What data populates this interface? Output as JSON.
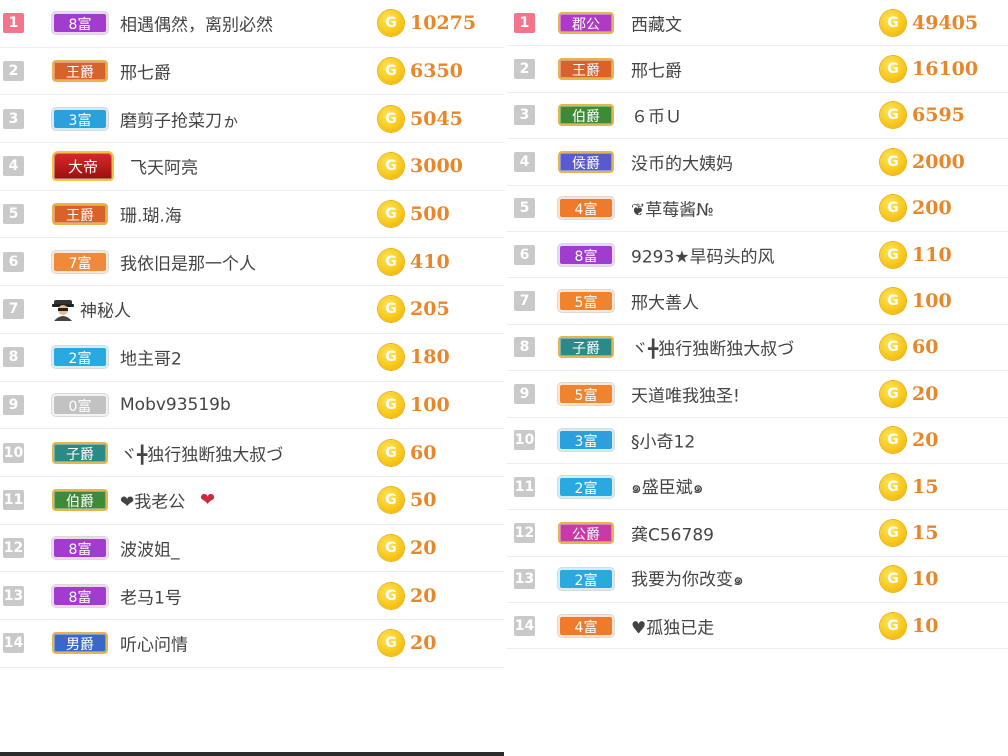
{
  "colors": {
    "rank_top": "#f2758b",
    "rank_default": "#c9c9c9",
    "amount": "#e8862a",
    "coin": "#f7c61a",
    "name_text": "#444444"
  },
  "coin_symbol": "G",
  "left_list": [
    {
      "rank": "1",
      "badge": "8富",
      "badge_color": "#a23ccf",
      "badge_type": "fu",
      "name": "相遇偶然，离别必然",
      "amount": "10275"
    },
    {
      "rank": "2",
      "badge": "王爵",
      "badge_color": "#d9612a",
      "badge_type": "title",
      "name": "邢七爵",
      "amount": "6350"
    },
    {
      "rank": "3",
      "badge": "3富",
      "badge_color": "#2aa0dc",
      "badge_type": "fu",
      "name": "磨剪子抢菜刀ゕ",
      "amount": "5045"
    },
    {
      "rank": "4",
      "badge": "大帝",
      "badge_color": "#c81e1e",
      "badge_type": "emperor",
      "name": "飞天阿亮",
      "amount": "3000"
    },
    {
      "rank": "5",
      "badge": "王爵",
      "badge_color": "#d9612a",
      "badge_type": "title",
      "name": "珊.瑚.海",
      "amount": "500"
    },
    {
      "rank": "6",
      "badge": "7富",
      "badge_color": "#f08a3a",
      "badge_type": "fu",
      "name": "我依旧是那一个人",
      "amount": "410"
    },
    {
      "rank": "7",
      "badge": "",
      "badge_color": "",
      "badge_type": "spy",
      "icon": "spy-icon",
      "name": "神秘人",
      "amount": "205"
    },
    {
      "rank": "8",
      "badge": "2富",
      "badge_color": "#2aa8e0",
      "badge_type": "fu",
      "name": "地主哥2",
      "amount": "180"
    },
    {
      "rank": "9",
      "badge": "0富",
      "badge_color": "#c2c2c2",
      "badge_type": "fu",
      "name": "Mobv93519b",
      "amount": "100"
    },
    {
      "rank": "10",
      "badge": "子爵",
      "badge_color": "#2a8a86",
      "badge_type": "title",
      "name": "ヾ╋独行独断独大叔づ",
      "amount": "60"
    },
    {
      "rank": "11",
      "badge": "伯爵",
      "badge_color": "#3e8a3a",
      "badge_type": "title",
      "name": "❤我老公",
      "icon": "heart-icon",
      "amount": "50"
    },
    {
      "rank": "12",
      "badge": "8富",
      "badge_color": "#a23ccf",
      "badge_type": "fu",
      "name": "波波姐_",
      "amount": "20"
    },
    {
      "rank": "13",
      "badge": "8富",
      "badge_color": "#a23ccf",
      "badge_type": "fu",
      "name": "老马1号",
      "amount": "20"
    },
    {
      "rank": "14",
      "badge": "男爵",
      "badge_color": "#3a68c8",
      "badge_type": "title",
      "name": "听心问情",
      "amount": "20"
    }
  ],
  "right_list": [
    {
      "rank": "1",
      "badge": "郡公",
      "badge_color": "#b03ac8",
      "badge_type": "title",
      "name": "西藏文",
      "amount": "49405"
    },
    {
      "rank": "2",
      "badge": "王爵",
      "badge_color": "#d9612a",
      "badge_type": "title",
      "name": "邢七爵",
      "amount": "16100"
    },
    {
      "rank": "3",
      "badge": "伯爵",
      "badge_color": "#3e8a3a",
      "badge_type": "title",
      "name": "６币Ｕ",
      "amount": "6595"
    },
    {
      "rank": "4",
      "badge": "侯爵",
      "badge_color": "#5a5ad0",
      "badge_type": "title",
      "name": "没币的大姨妈",
      "amount": "2000"
    },
    {
      "rank": "5",
      "badge": "4富",
      "badge_color": "#ee7a2a",
      "badge_type": "fu",
      "name": "❦草莓酱№",
      "amount": "200"
    },
    {
      "rank": "6",
      "badge": "8富",
      "badge_color": "#a23ccf",
      "badge_type": "fu",
      "name": "9293★旱码头的风",
      "amount": "110"
    },
    {
      "rank": "7",
      "badge": "5富",
      "badge_color": "#f0842e",
      "badge_type": "fu",
      "name": "邢大善人",
      "amount": "100"
    },
    {
      "rank": "8",
      "badge": "子爵",
      "badge_color": "#2a8a86",
      "badge_type": "title",
      "name": "ヾ╋独行独断独大叔づ",
      "amount": "60"
    },
    {
      "rank": "9",
      "badge": "5富",
      "badge_color": "#f0842e",
      "badge_type": "fu",
      "name": "天道唯我独圣!",
      "amount": "20"
    },
    {
      "rank": "10",
      "badge": "3富",
      "badge_color": "#2aa0dc",
      "badge_type": "fu",
      "name": "§小奇12",
      "amount": "20"
    },
    {
      "rank": "11",
      "badge": "2富",
      "badge_color": "#2aa8e0",
      "badge_type": "fu",
      "name": "๑盛臣斌๑",
      "amount": "15"
    },
    {
      "rank": "12",
      "badge": "公爵",
      "badge_color": "#c83aa8",
      "badge_type": "title",
      "name": "龚C56789",
      "amount": "15"
    },
    {
      "rank": "13",
      "badge": "2富",
      "badge_color": "#2aa8e0",
      "badge_type": "fu",
      "name": "我要为你改变๑",
      "amount": "10"
    },
    {
      "rank": "14",
      "badge": "4富",
      "badge_color": "#ee7a2a",
      "badge_type": "fu",
      "name": "♥孤独已走",
      "amount": "10"
    }
  ]
}
